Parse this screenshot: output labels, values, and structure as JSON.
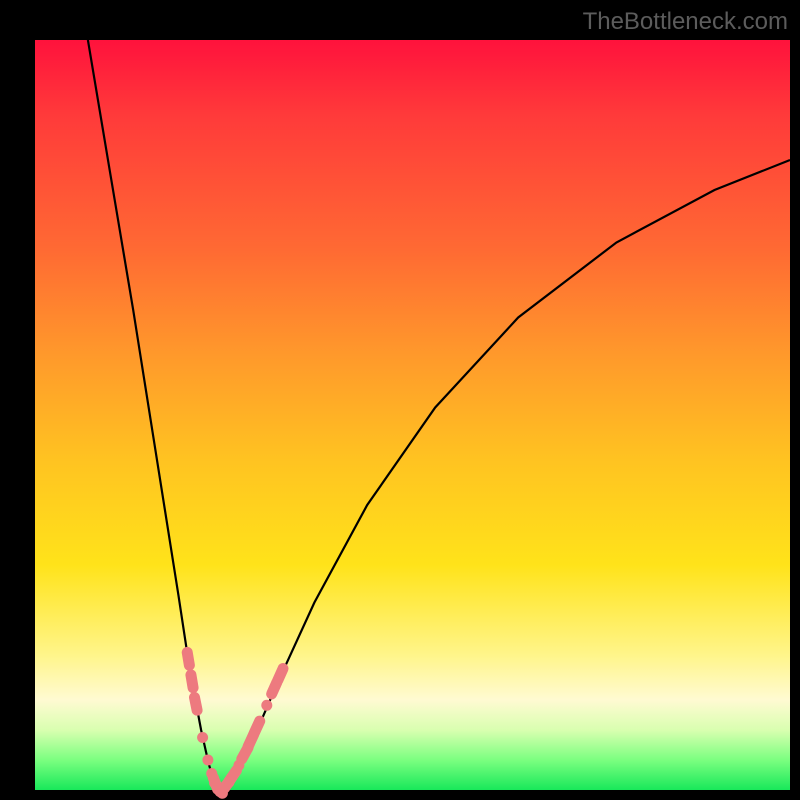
{
  "watermark": "TheBottleneck.com",
  "colors": {
    "marker": "#ed7a7f",
    "curve": "#000000",
    "frame": "#000000"
  },
  "chart_data": {
    "type": "line",
    "title": "",
    "xlabel": "",
    "ylabel": "",
    "xlim": [
      0,
      100
    ],
    "ylim": [
      0,
      100
    ],
    "curve": {
      "left_branch_x": [
        7,
        10,
        13,
        16,
        19,
        20.5,
        22,
        23,
        23.7,
        24.2,
        24.6
      ],
      "left_branch_y": [
        100,
        82,
        64,
        45,
        26,
        16,
        8,
        3.5,
        1.2,
        0.3,
        0
      ],
      "right_branch_x": [
        24.6,
        25.2,
        26,
        27.2,
        29,
        32,
        37,
        44,
        53,
        64,
        77,
        90,
        100
      ],
      "right_branch_y": [
        0,
        0.5,
        1.5,
        3.5,
        7,
        14,
        25,
        38,
        51,
        63,
        73,
        80,
        84
      ]
    },
    "markers": {
      "note": "pink segment markers overlaid on the curve near the minimum, both branches",
      "left_cluster": [
        {
          "x": 20.3,
          "y": 17.5,
          "kind": "cap"
        },
        {
          "x": 20.8,
          "y": 14.5,
          "kind": "cap"
        },
        {
          "x": 21.3,
          "y": 11.5,
          "kind": "cap"
        },
        {
          "x": 22.2,
          "y": 7.0,
          "kind": "dot"
        },
        {
          "x": 22.9,
          "y": 4.0,
          "kind": "dot"
        },
        {
          "x": 23.4,
          "y": 2.2,
          "kind": "dot"
        },
        {
          "x": 23.9,
          "y": 0.9,
          "kind": "cap"
        },
        {
          "x": 24.3,
          "y": 0.25,
          "kind": "cap"
        }
      ],
      "right_cluster": [
        {
          "x": 25.1,
          "y": 0.4,
          "kind": "cap"
        },
        {
          "x": 25.6,
          "y": 1.0,
          "kind": "cap"
        },
        {
          "x": 26.2,
          "y": 1.9,
          "kind": "cap"
        },
        {
          "x": 27.0,
          "y": 3.3,
          "kind": "dot"
        },
        {
          "x": 27.8,
          "y": 4.9,
          "kind": "cap"
        },
        {
          "x": 28.6,
          "y": 6.6,
          "kind": "cap"
        },
        {
          "x": 29.4,
          "y": 8.4,
          "kind": "cap"
        },
        {
          "x": 30.7,
          "y": 11.3,
          "kind": "dot"
        },
        {
          "x": 31.7,
          "y": 13.6,
          "kind": "cap"
        },
        {
          "x": 32.5,
          "y": 15.4,
          "kind": "cap"
        }
      ]
    }
  }
}
